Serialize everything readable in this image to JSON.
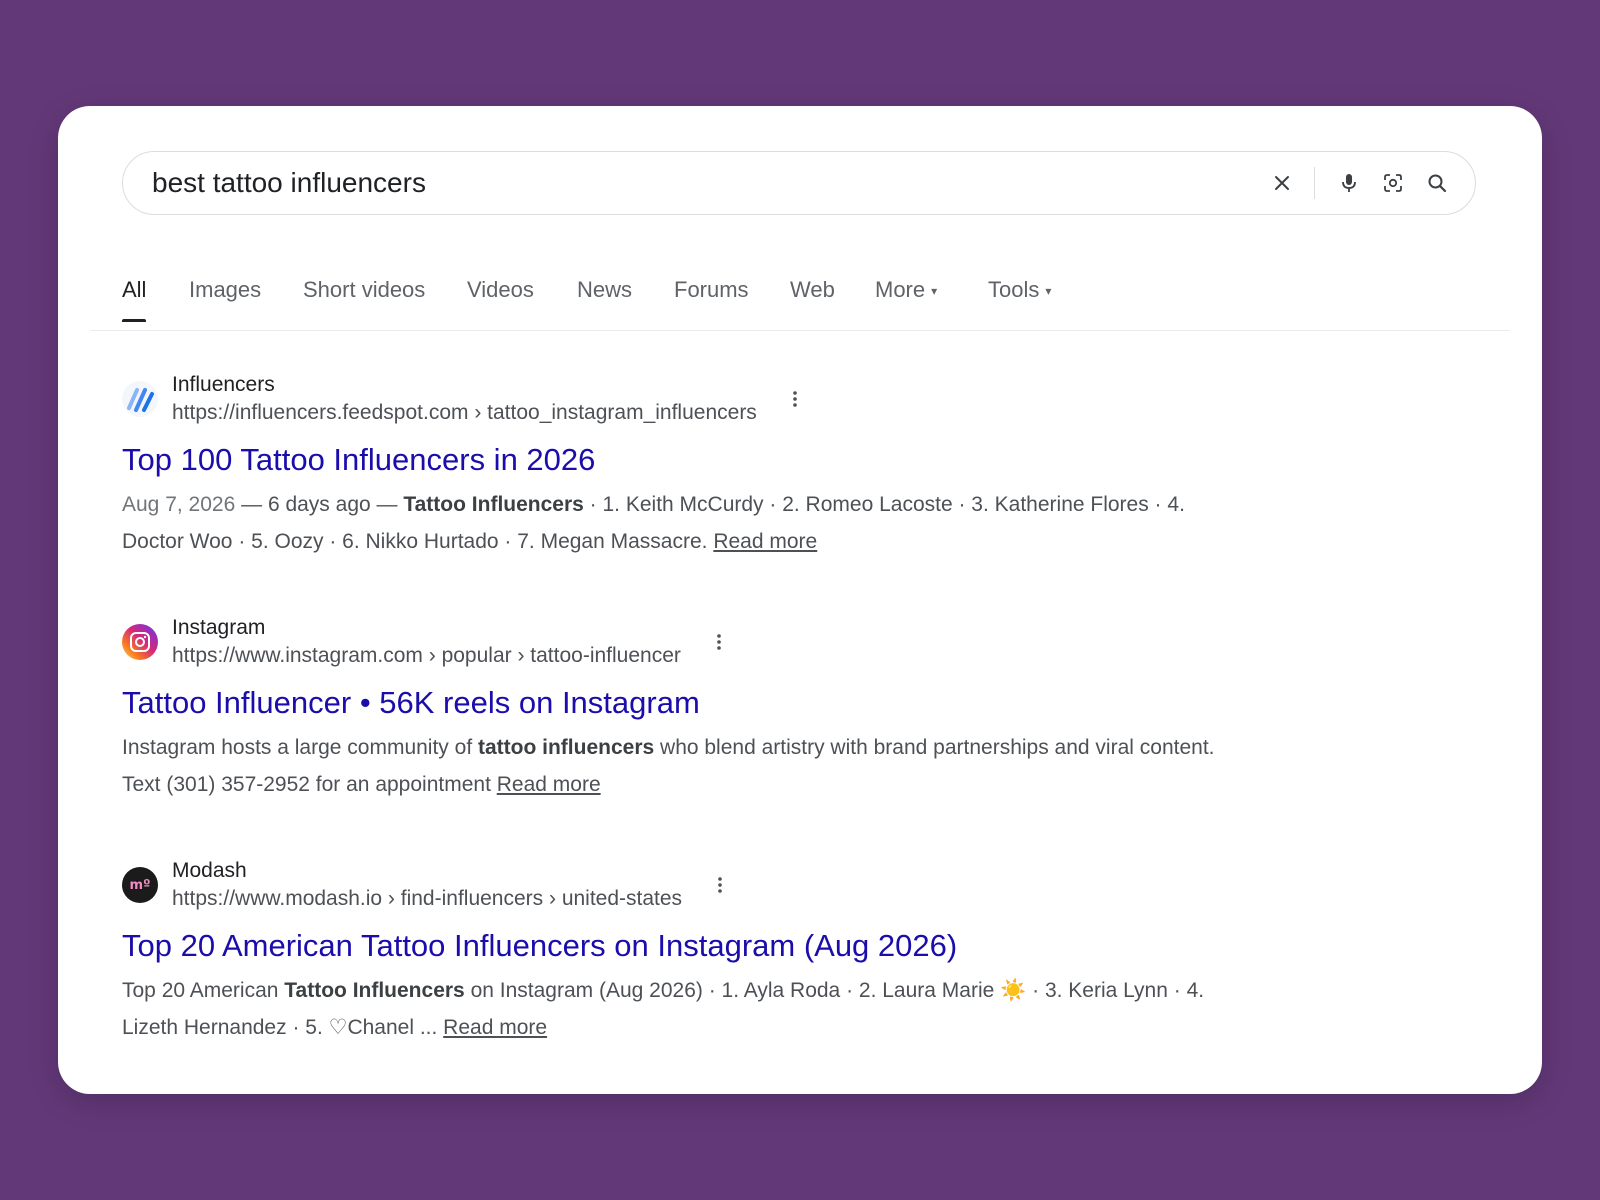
{
  "search": {
    "query": "best tattoo influencers",
    "icons": [
      "close-icon",
      "microphone-icon",
      "lens-icon",
      "search-icon"
    ]
  },
  "tabs": [
    {
      "label": "All",
      "active": true
    },
    {
      "label": "Images"
    },
    {
      "label": "Short videos"
    },
    {
      "label": "Videos"
    },
    {
      "label": "News"
    },
    {
      "label": "Forums"
    },
    {
      "label": "Web"
    },
    {
      "label": "More",
      "caret": "▾"
    },
    {
      "label": "Tools",
      "caret": "▾"
    }
  ],
  "results": [
    {
      "site_name": "Influencers",
      "url": "https://influencers.feedspot.com › tattoo_instagram_influencers",
      "title": "Top 100 Tattoo Influencers in 2026",
      "date": "Aug 7, 2026",
      "sep1": " — ",
      "ago": "6 days ago",
      "sep2": " — ",
      "bold": "Tattoo Influencers",
      "rest": " · 1. Keith McCurdy · 2. Romeo Lacoste · 3. Katherine Flores · 4. Doctor Woo · 5. Oozy · 6. Nikko Hurtado · 7. Megan Massacre. ",
      "read_more": "Read more"
    },
    {
      "site_name": "Instagram",
      "url": "https://www.instagram.com › popular › tattoo-influencer",
      "title": "Tattoo Influencer • 56K reels on Instagram",
      "pre": "Instagram hosts a large community of ",
      "bold": "tattoo influencers",
      "rest": " who blend artistry with brand partnerships and viral content. Text (301) 357-2952 for an appointment ",
      "read_more": "Read more"
    },
    {
      "site_name": "Modash",
      "url": "https://www.modash.io › find-influencers › united-states",
      "title": "Top 20 American Tattoo Influencers on Instagram (Aug 2026)",
      "favicon_text": "mº",
      "pre": "Top 20 American ",
      "bold": "Tattoo Influencers",
      "rest": " on Instagram (Aug 2026) · 1. Ayla Roda · 2. Laura Marie ☀️  · 3. Keria Lynn · 4. Lizeth Hernandez · 5. ♡Chanel ... ",
      "read_more": "Read more"
    }
  ],
  "colors": {
    "background": "#633878",
    "link": "#1a0dab",
    "text": "#202124",
    "muted": "#4d5156"
  }
}
